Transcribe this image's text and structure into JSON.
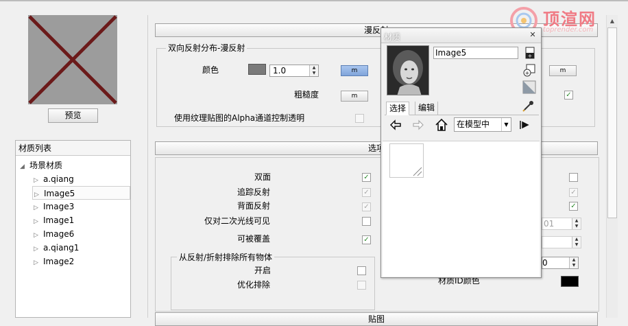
{
  "left_panel": {
    "preview_button": "预览",
    "material_list": {
      "header": "材质列表",
      "root": "场景材质",
      "items": [
        "a.qiang",
        "Image5",
        "Image3",
        "Image1",
        "Image6",
        "a.qiang1",
        "Image2"
      ],
      "selected": "Image5"
    }
  },
  "right_panel": {
    "section_diffuse": "漫反射",
    "brdf_group_title": "双向反射分布-漫反射",
    "color_label": "颜色",
    "color_value": "1.0",
    "m_button": "m",
    "roughness_label": "粗糙度",
    "alpha_label": "使用纹理贴图的Alpha通道控制透明",
    "section_options": "选项",
    "options": [
      {
        "label": "双面",
        "checked": true,
        "disabled": false
      },
      {
        "label": "追踪反射",
        "checked": true,
        "disabled": true
      },
      {
        "label": "背面反射",
        "checked": true,
        "disabled": true
      },
      {
        "label": "仅对二次光线可见",
        "checked": false,
        "disabled": false
      },
      {
        "label": "可被覆盖",
        "checked": true,
        "disabled": false
      }
    ],
    "exclude_group_title": "从反射/折射排除所有物体",
    "exclude_options": [
      {
        "label": "开启",
        "checked": false,
        "disabled": false
      },
      {
        "label": "优化排除",
        "checked": false,
        "disabled": true
      }
    ],
    "partial_value_1": "01",
    "partial_value_2": "0",
    "material_id_color_label": "材质ID颜色",
    "section_maps": "贴图"
  },
  "watermark": {
    "text": "顶渲网",
    "url": "toprender.com"
  },
  "material_window": {
    "title": "材质",
    "name": "Image5",
    "tabs": [
      "选择",
      "编辑"
    ],
    "active_tab": "选择",
    "location": "在模型中"
  },
  "colors": {
    "accent_check": "#2d8a2d",
    "material_id_color": "#000000",
    "preview_cross": "#6b1a1a",
    "watermark": "#f07a84"
  }
}
